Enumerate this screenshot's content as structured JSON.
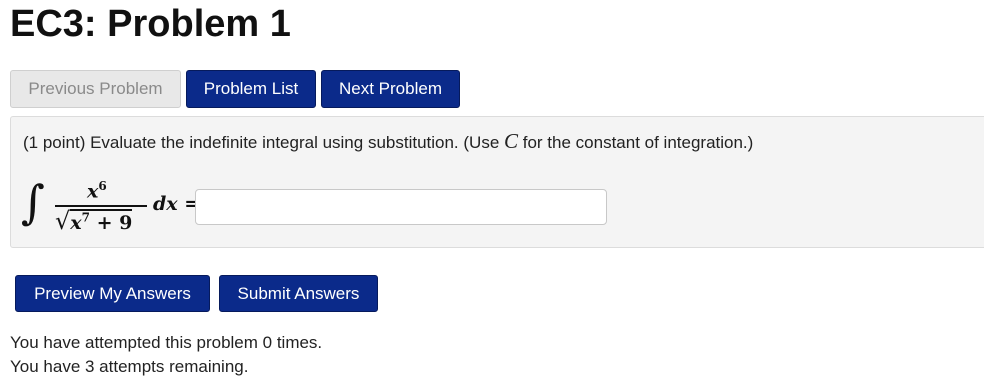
{
  "page": {
    "title": "EC3: Problem 1"
  },
  "nav": {
    "previous_label": "Previous Problem",
    "list_label": "Problem List",
    "next_label": "Next Problem"
  },
  "problem": {
    "text_before": "(1 point) Evaluate the indefinite integral using substitution. (Use ",
    "constant_symbol": "C",
    "text_after": " for the constant of integration.)",
    "integral_sign": "∫",
    "numerator_base": "x",
    "numerator_exp": "6",
    "denominator_radical": "√",
    "denominator_base": "x",
    "denominator_exp": "7",
    "denominator_rest": " + 9",
    "differential": "dx  =",
    "answer_value": ""
  },
  "actions": {
    "preview_label": "Preview My Answers",
    "submit_label": "Submit Answers"
  },
  "status": {
    "attempts_line": "You have attempted this problem 0 times.",
    "remaining_line": "You have 3 attempts remaining."
  },
  "colors": {
    "primary_button": "#0b2a8a",
    "disabled_button": "#e8e8e8",
    "problem_background": "#f4f4f4"
  }
}
